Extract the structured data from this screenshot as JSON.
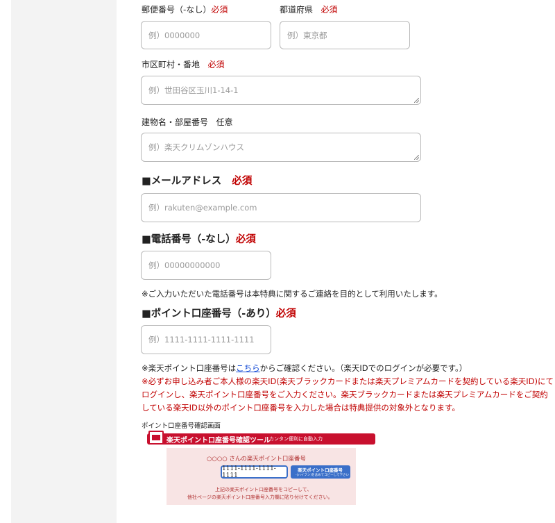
{
  "form": {
    "postal": {
      "label": "郵便番号（-なし）",
      "required": "必須",
      "placeholder": "例）0000000"
    },
    "prefecture": {
      "label": "都道府県",
      "required": "必須",
      "placeholder": "例）東京都"
    },
    "city": {
      "label": "市区町村・番地",
      "required": "必須",
      "placeholder": "例）世田谷区玉川1-14-1"
    },
    "building": {
      "label": "建物名・部屋番号",
      "optional": "任意",
      "placeholder": "例）楽天クリムゾンハウス"
    },
    "email": {
      "heading": "■メールアドレス",
      "required": "必須",
      "placeholder": "例）rakuten@example.com"
    },
    "phone": {
      "heading": "■電話番号（-なし）",
      "required": "必須",
      "placeholder": "例）00000000000",
      "note": "※ご入力いただいた電話番号は本特典に関するご連絡を目的として利用いたします。"
    },
    "point": {
      "heading": "■ポイント口座番号（-あり）",
      "required": "必須",
      "placeholder": "例）1111-1111-1111-1111",
      "note_prefix": "※楽天ポイント口座番号は",
      "note_link": "こちら",
      "note_suffix": "からご確認ください。（楽天IDでのログインが必要です。）",
      "warning_line1": "※必ずお申し込み者ご本人様の楽天ID(楽天ブラックカードまたは楽天プレミアムカードを契約している楽天ID)にて",
      "warning_line2": "ログインし、楽天ポイント口座番号をご入力ください。楽天ブラックカードまたは楽天プレミアムカードをご契約",
      "warning_line3": "している楽天ID以外のポイント口座番号を入力した場合は特典提供の対象外となります。",
      "screen_caption": "ポイント口座番号確認画面"
    }
  },
  "tool_image": {
    "title": "楽天ポイント口座番号確認ツール",
    "subtitle": "カンタン便利に自動入力",
    "name_line": "○○○○ さんの楽天ポイント口座番号",
    "number": "1111-1111-1111-1111",
    "copy_button": "楽天ポイント口座番号",
    "copy_button_sub": "-(ハイフン)を含めてコピーして下さい",
    "desc_line1": "上記の楽天ポイント口座番号をコピーして、",
    "desc_line2": "他社ページの楽天ポイント口座番号入力欄に貼り付けてください。"
  },
  "colors": {
    "required": "#c00000",
    "link": "#1a4fd6",
    "tool_red": "#c8102e",
    "tool_blue": "#3a6fc9"
  }
}
